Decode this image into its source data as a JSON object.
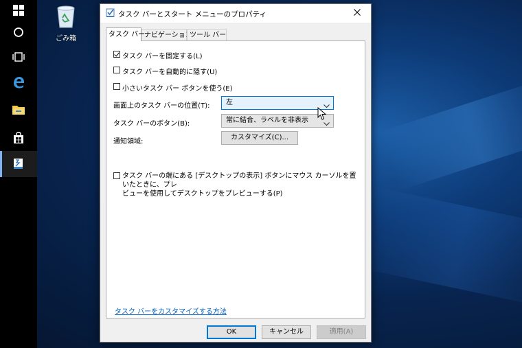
{
  "desktop": {
    "recycle_bin_label": "ごみ箱"
  },
  "taskbar": {
    "buttons": [
      "start-icon",
      "search-icon",
      "task-view-icon",
      "edge-icon",
      "file-explorer-icon",
      "store-icon",
      "taskbar-properties-icon"
    ],
    "accent": "#7fb4ef"
  },
  "dialog": {
    "title": "タスク バーとスタート メニューのプロパティ",
    "tabs": [
      {
        "label": "タスク バー"
      },
      {
        "label": "ナビゲーション"
      },
      {
        "label": "ツール バー"
      }
    ],
    "options": {
      "lock_taskbar": {
        "label": "タスク バーを固定する(L)",
        "checked": true
      },
      "auto_hide": {
        "label": "タスク バーを自動的に隠す(U)",
        "checked": false
      },
      "small_buttons": {
        "label": "小さいタスク バー ボタンを使う(E)",
        "checked": false
      }
    },
    "position": {
      "label": "画面上のタスク バーの位置(T):",
      "value": "左"
    },
    "buttons_combine": {
      "label": "タスク バーのボタン(B):",
      "value": "常に結合、ラベルを非表示"
    },
    "notification": {
      "label": "通知領域:",
      "button": "カスタマイズ(C)..."
    },
    "peek": {
      "label_line1": "タスク バーの端にある [デスクトップの表示] ボタンにマウス カーソルを置いたときに、プレ",
      "label_line2": "ビューを使用してデスクトップをプレビューする(P)",
      "checked": false
    },
    "help_link": "タスク バーをカスタマイズする方法",
    "ok": "OK",
    "cancel": "キャンセル",
    "apply": "適用(A)"
  }
}
